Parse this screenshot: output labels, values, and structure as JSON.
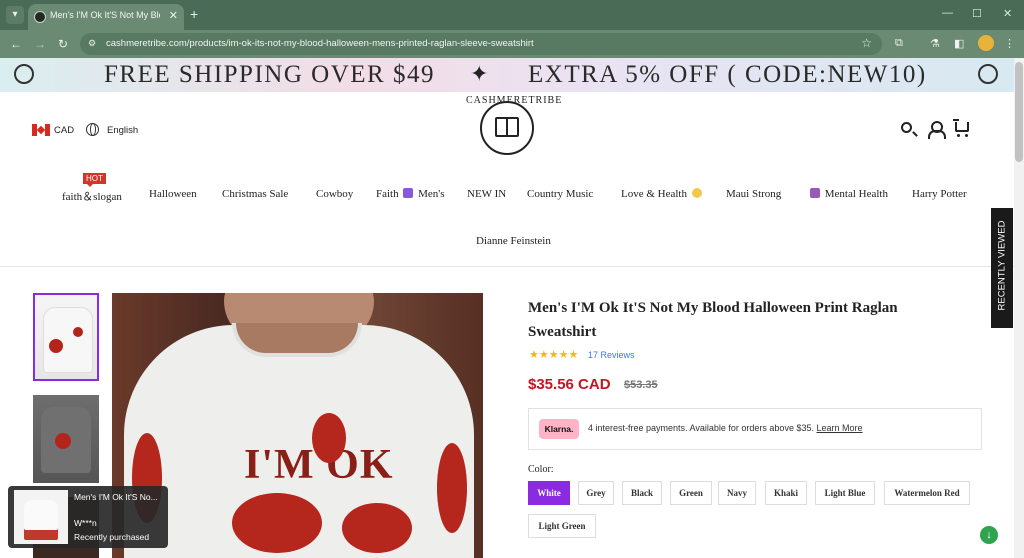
{
  "browser": {
    "tab_title": "Men's I'M Ok It'S Not My Bloo",
    "url": "cashmeretribe.com/products/im-ok-its-not-my-blood-halloween-mens-printed-raglan-sleeve-sweatshirt"
  },
  "banner": {
    "left": "FREE SHIPPING OVER $49",
    "right": "EXTRA 5% OFF ( CODE:NEW10)"
  },
  "header": {
    "currency": "CAD",
    "language": "English",
    "logo_text": "CASHMERETRIBE"
  },
  "nav": {
    "hot_badge": "HOT",
    "items": [
      "faith＆slogan",
      "Halloween",
      "Christmas Sale",
      "Cowboy",
      "Faith",
      "Men's",
      "NEW IN",
      "Country Music",
      "Love & Health",
      "Maui Strong",
      "Mental Health",
      "Harry Potter",
      "Dianne Feinstein"
    ]
  },
  "recently_viewed": "RECENTLY VIEWED",
  "product": {
    "title": "Men's I'M Ok It'S Not My Blood Halloween Print Raglan Sweatshirt",
    "reviews": "17 Reviews",
    "rating": 5,
    "price": "$35.56 CAD",
    "old_price": "$53.35",
    "print_text": "I'M OK",
    "klarna": {
      "badge": "Klarna.",
      "text": "4 interest-free payments. Available for orders above $35.",
      "link": "Learn More"
    },
    "color_label": "Color:",
    "colors": [
      "White",
      "Grey",
      "Black",
      "Green",
      "Navy",
      "Khaki",
      "Light Blue",
      "Watermelon Red",
      "Light Green"
    ],
    "selected_color": "White"
  },
  "popup": {
    "title": "Men's I'M Ok It'S No...",
    "name": "W***n",
    "status": "Recently purchased"
  },
  "colors": {
    "accent": "#8a2be2",
    "price": "#c8141e",
    "chrome": "#4a6b55"
  }
}
